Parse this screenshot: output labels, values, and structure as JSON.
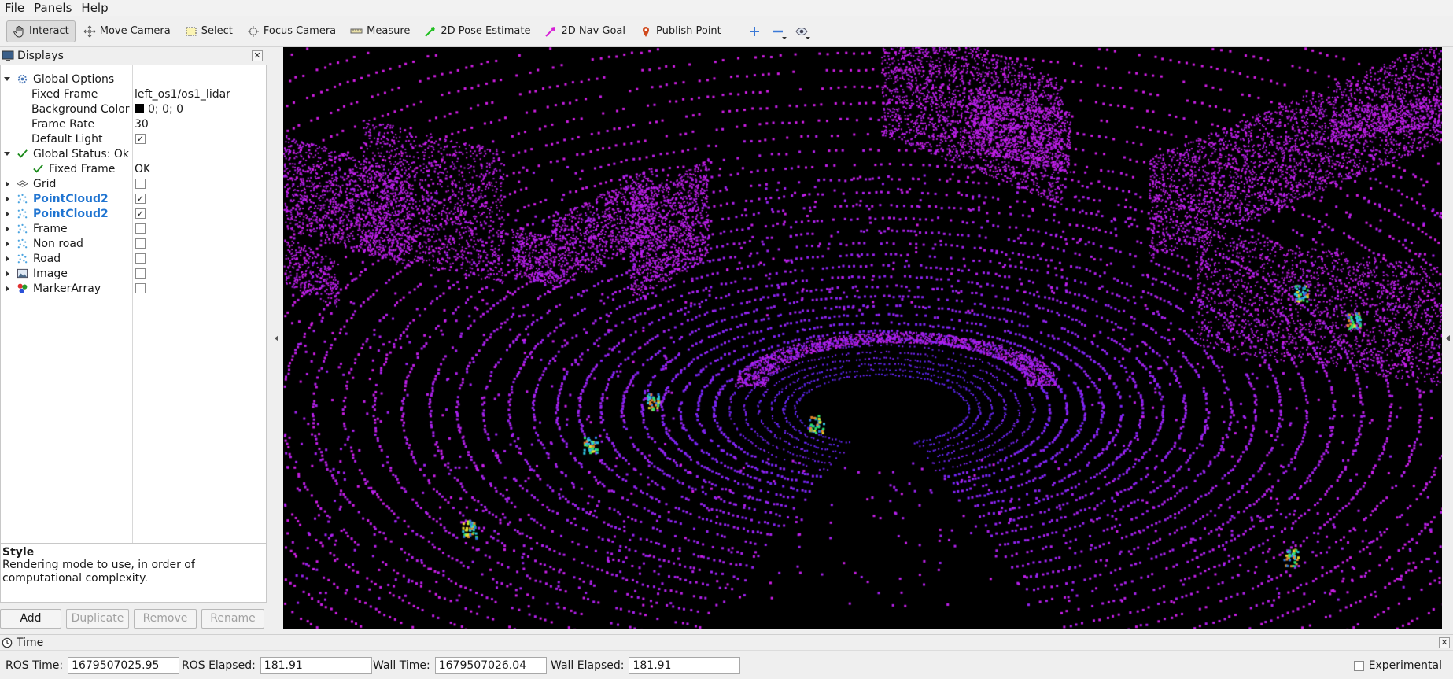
{
  "menu": {
    "items": [
      "File",
      "Panels",
      "Help"
    ]
  },
  "toolbar": {
    "tools": [
      {
        "label": "Interact",
        "icon": "hand-icon",
        "active": true
      },
      {
        "label": "Move Camera",
        "icon": "move-camera-icon",
        "active": false
      },
      {
        "label": "Select",
        "icon": "select-box-icon",
        "active": false
      },
      {
        "label": "Focus Camera",
        "icon": "focus-crosshair-icon",
        "active": false
      },
      {
        "label": "Measure",
        "icon": "ruler-icon",
        "active": false
      },
      {
        "label": "2D Pose Estimate",
        "icon": "green-arrow-icon",
        "active": false
      },
      {
        "label": "2D Nav Goal",
        "icon": "magenta-arrow-icon",
        "active": false
      },
      {
        "label": "Publish Point",
        "icon": "map-pin-icon",
        "active": false
      }
    ],
    "extra_icons": [
      "plus-icon",
      "minus-icon",
      "eye-icon"
    ]
  },
  "displays": {
    "title": "Displays",
    "rows": [
      {
        "label": "Global Options",
        "value": "",
        "icon": "gear-icon",
        "indent": 0,
        "expanded": true
      },
      {
        "label": "Fixed Frame",
        "value": "left_os1/os1_lidar",
        "indent": 1
      },
      {
        "label": "Background Color",
        "value": "0; 0; 0",
        "indent": 1,
        "swatch": "#000000"
      },
      {
        "label": "Frame Rate",
        "value": "30",
        "indent": 1
      },
      {
        "label": "Default Light",
        "indent": 1,
        "checkbox": true,
        "checked": true
      },
      {
        "label": "Global Status: Ok",
        "value": "",
        "icon": "check-icon",
        "indent": 0,
        "expanded": true
      },
      {
        "label": "Fixed Frame",
        "value": "OK",
        "icon": "check-icon",
        "indent": 1
      },
      {
        "label": "Grid",
        "icon": "grid-icon",
        "indent": 0,
        "expanded": false,
        "checkbox": true,
        "checked": false
      },
      {
        "label": "PointCloud2",
        "icon": "pointcloud-icon",
        "indent": 0,
        "expanded": false,
        "checkbox": true,
        "checked": true,
        "highlight": true
      },
      {
        "label": "PointCloud2",
        "icon": "pointcloud-icon",
        "indent": 0,
        "expanded": false,
        "checkbox": true,
        "checked": true,
        "highlight": true
      },
      {
        "label": "Frame",
        "icon": "pointcloud-icon",
        "indent": 0,
        "expanded": false,
        "checkbox": true,
        "checked": false
      },
      {
        "label": "Non road",
        "icon": "pointcloud-icon",
        "indent": 0,
        "expanded": false,
        "checkbox": true,
        "checked": false
      },
      {
        "label": "Road",
        "icon": "pointcloud-icon",
        "indent": 0,
        "expanded": false,
        "checkbox": true,
        "checked": false
      },
      {
        "label": "Image",
        "icon": "image-icon",
        "indent": 0,
        "expanded": false,
        "checkbox": true,
        "checked": false
      },
      {
        "label": "MarkerArray",
        "icon": "marker-array-icon",
        "indent": 0,
        "expanded": false,
        "checkbox": true,
        "checked": false
      }
    ],
    "style_title": "Style",
    "style_desc": "Rendering mode to use, in order of computational complexity.",
    "buttons": {
      "add": "Add",
      "duplicate": "Duplicate",
      "remove": "Remove",
      "rename": "Rename"
    }
  },
  "time": {
    "title": "Time",
    "ros_time_label": "ROS Time:",
    "ros_time": "1679507025.95",
    "ros_elapsed_label": "ROS Elapsed:",
    "ros_elapsed": "181.91",
    "wall_time_label": "Wall Time:",
    "wall_time": "1679507026.04",
    "wall_elapsed_label": "Wall Elapsed:",
    "wall_elapsed": "181.91",
    "experimental_label": "Experimental"
  },
  "colors": {
    "pointcloud_primary": "#d21ee6",
    "pointcloud_secondary": "#5a28ff",
    "highlight_label": "#1f74d1",
    "background": "#000000"
  }
}
